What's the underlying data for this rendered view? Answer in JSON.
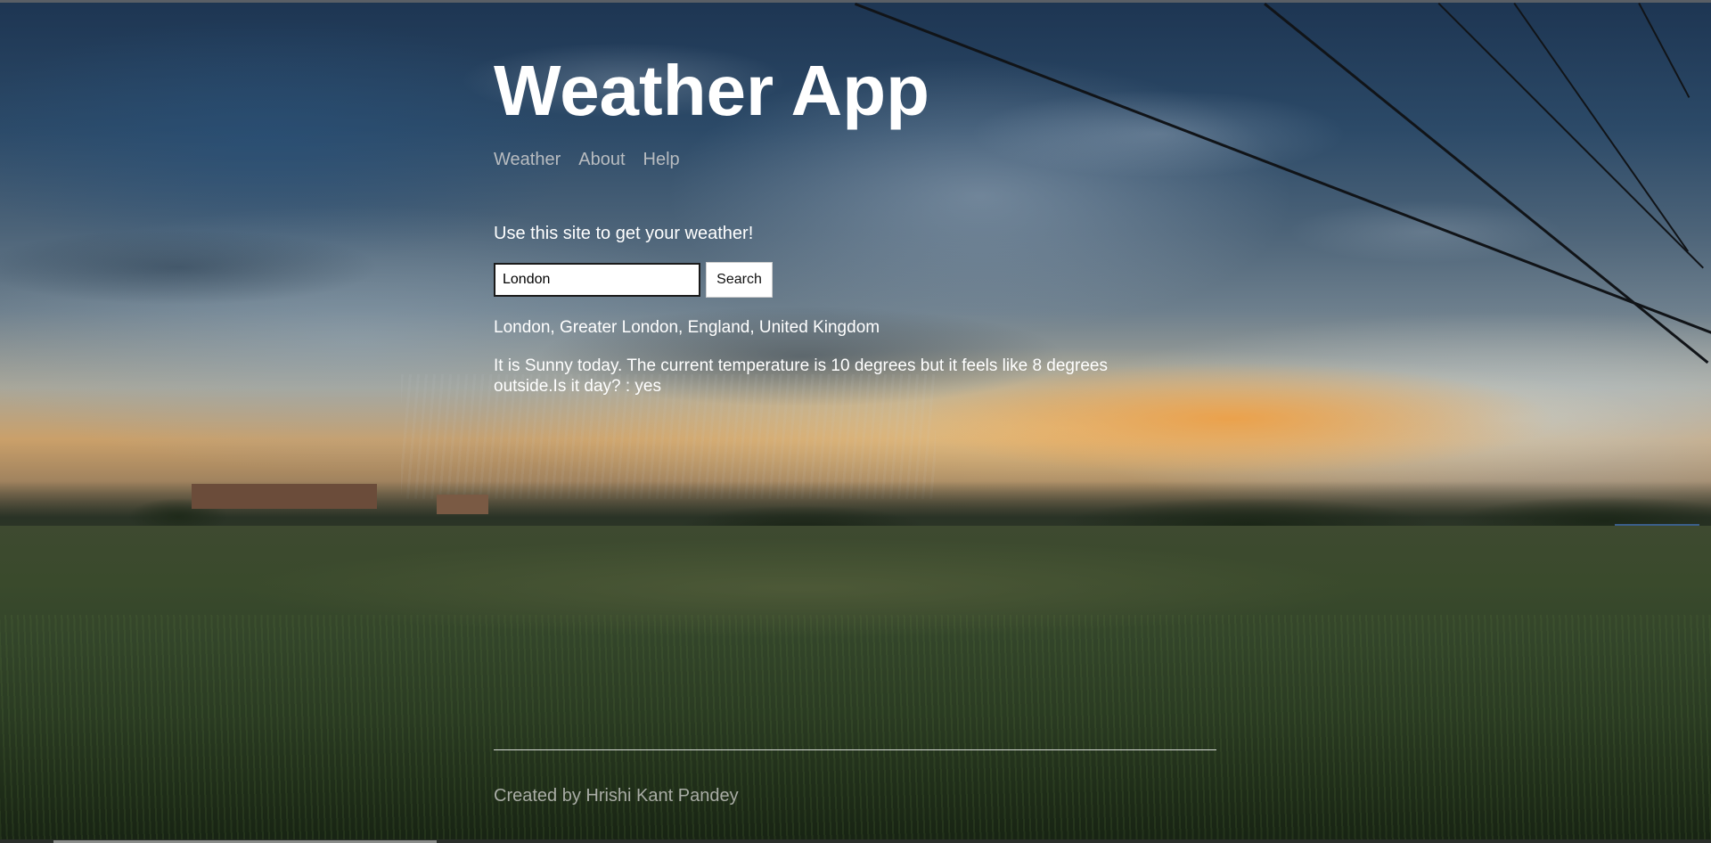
{
  "header": {
    "title": "Weather App",
    "nav": [
      {
        "label": "Weather"
      },
      {
        "label": "About"
      },
      {
        "label": "Help"
      }
    ]
  },
  "main": {
    "intro": "Use this site to get your weather!",
    "search": {
      "value": "London",
      "button_label": "Search"
    },
    "location": "London, Greater London, England, United Kingdom",
    "forecast": "It is Sunny today. The current temperature is 10 degrees but it feels like 8 degrees outside.Is it day? : yes"
  },
  "footer": {
    "credit": "Created by Hrishi Kant Pandey"
  },
  "colors": {
    "title": "#ffffff",
    "nav_link": "#b8bcc0",
    "footer_text": "#a9aca5",
    "button_bg": "#ffffff"
  },
  "background": {
    "description_icon": "storm-landscape-image"
  }
}
